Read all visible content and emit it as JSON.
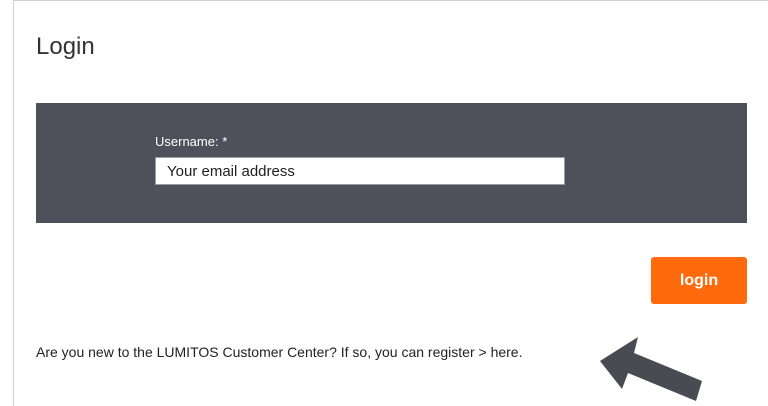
{
  "page": {
    "title": "Login"
  },
  "login_form": {
    "username_label": "Username: *",
    "username_placeholder": "Your email address",
    "username_value": "",
    "submit_label": "login"
  },
  "register": {
    "prompt_text": "Are you new to the LUMITOS Customer Center? If so, you can register > ",
    "link_label": "here."
  },
  "colors": {
    "panel_background": "#50505a",
    "button_background": "#ff6a0d",
    "arrow": "#4a4a52"
  },
  "icons": {
    "pointer_arrow": "arrow-pointing-up-left-icon"
  }
}
